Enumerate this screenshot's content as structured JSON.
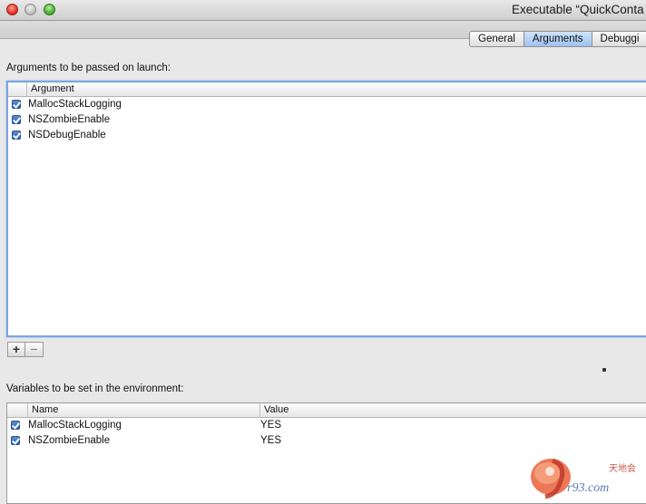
{
  "window": {
    "title": "Executable “QuickConta"
  },
  "tabs": [
    {
      "label": "General",
      "active": false
    },
    {
      "label": "Arguments",
      "active": true
    },
    {
      "label": "Debuggi",
      "active": false
    }
  ],
  "arguments": {
    "label": "Arguments to be passed on launch:",
    "column_header": "Argument",
    "rows": [
      {
        "checked": true,
        "value": "MallocStackLogging"
      },
      {
        "checked": true,
        "value": "NSZombieEnable"
      },
      {
        "checked": true,
        "value": "NSDebugEnable"
      }
    ],
    "add_label": "+",
    "remove_label": "−"
  },
  "environment": {
    "label": "Variables to be set in the environment:",
    "columns": [
      "Name",
      "Value"
    ],
    "rows": [
      {
        "checked": true,
        "name": "MallocStackLogging",
        "value": "YES"
      },
      {
        "checked": true,
        "name": "NSZombieEnable",
        "value": "YES"
      }
    ]
  },
  "watermark": {
    "text": "天地会"
  },
  "colors": {
    "selected_tab": "#9ec3f0",
    "checkbox": "#2d5fb3",
    "focus_ring": "#7ea6dd"
  }
}
